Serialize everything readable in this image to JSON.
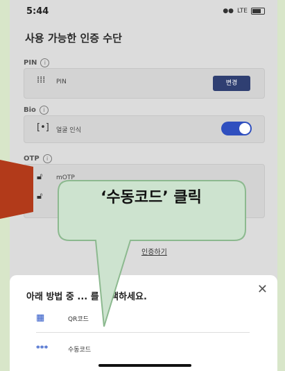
{
  "status_bar": {
    "time": "5:44",
    "network": "LTE"
  },
  "page_title": "사용 가능한 인증 수단",
  "sections": {
    "pin": {
      "label": "PIN",
      "item_label": "PIN",
      "button_label": "변경"
    },
    "bio": {
      "label": "Bio",
      "item_label": "얼굴 인식",
      "toggle_on": true
    },
    "otp": {
      "label": "OTP",
      "item1_label": "mOTP",
      "item2_label": ""
    }
  },
  "alt_link": "인증하기",
  "sheet": {
    "title": "아래 방법 중 ... 를 선택하세요.",
    "options": [
      {
        "icon": "qr-code-icon",
        "label": "QR코드"
      },
      {
        "icon": "keypad-icon",
        "label": "수동코드"
      }
    ]
  },
  "callout": {
    "text": "‘수동코드’ 클릭"
  },
  "colors": {
    "accent": "#2f4fbf",
    "button": "#2f3f72",
    "callout_fill": "#cde3cf",
    "callout_border": "#8cb98f",
    "arrow": "#b23a1a"
  }
}
